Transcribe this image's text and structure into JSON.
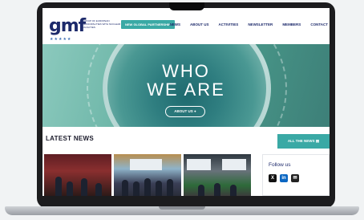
{
  "header": {
    "logo": "gmf",
    "tagline": "GROUP OF EUROPEAN MUNICIPALITIES WITH NUCLEAR FACILITIES",
    "partnership_button": "NEW GLOBAL PARTNERSHIP",
    "nav": [
      "NEWS",
      "ABOUT US",
      "ACTIVITIES",
      "NEWSLETTER",
      "MEMBERS",
      "CONTACT"
    ]
  },
  "hero": {
    "title_line1": "WHO",
    "title_line2": "WE ARE",
    "button": "ABOUT US"
  },
  "news": {
    "heading": "LATEST NEWS",
    "all_button": "ALL THE NEWS"
  },
  "follow": {
    "title": "Follow us",
    "icons": [
      "x-icon",
      "linkedin-icon",
      "mail-icon"
    ]
  },
  "colors": {
    "brand_navy": "#1d2a6b",
    "accent_teal": "#3aa9a5"
  }
}
